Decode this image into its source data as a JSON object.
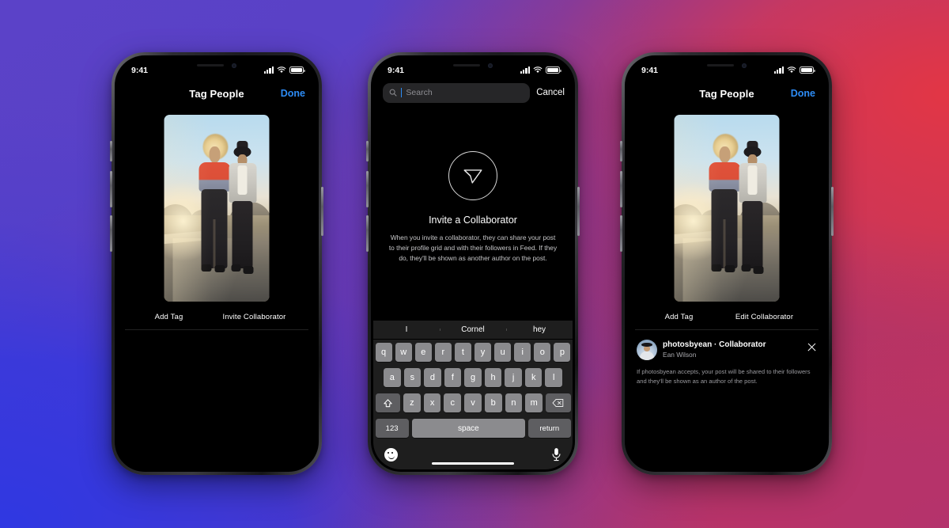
{
  "background": {
    "colors": [
      "#5b42c8",
      "#2f38e2",
      "#e23645",
      "#b4336c"
    ]
  },
  "accent_color": "#2d8cf5",
  "status_bar": {
    "time": "9:41",
    "cellular_icon": "signal-bars-icon",
    "wifi_icon": "wifi-icon",
    "battery_icon": "battery-icon"
  },
  "phones": [
    {
      "id": "phone-tag-people",
      "nav": {
        "title": "Tag People",
        "action": "Done"
      },
      "actions": {
        "left": "Add Tag",
        "right": "Invite Collaborator"
      }
    },
    {
      "id": "phone-invite-search",
      "search": {
        "placeholder": "Search",
        "value": "",
        "icon": "search-icon",
        "cancel": "Cancel"
      },
      "empty_state": {
        "icon": "send-paper-plane-icon",
        "title": "Invite a Collaborator",
        "body": "When you invite a collaborator, they can share your post to their profile grid and with their followers in Feed. If they do, they'll be shown as another author on the post."
      },
      "keyboard": {
        "predictions": [
          "I",
          "Cornel",
          "hey"
        ],
        "row1": [
          "q",
          "w",
          "e",
          "r",
          "t",
          "y",
          "u",
          "i",
          "o",
          "p"
        ],
        "row2": [
          "a",
          "s",
          "d",
          "f",
          "g",
          "h",
          "j",
          "k",
          "l"
        ],
        "row3": [
          "z",
          "x",
          "c",
          "v",
          "b",
          "n",
          "m"
        ],
        "shift_icon": "shift-arrow-icon",
        "backspace_icon": "backspace-icon",
        "numbers_key": "123",
        "space_key": "space",
        "return_key": "return",
        "emoji_icon": "emoji-smiley-icon",
        "dictation_icon": "microphone-icon"
      }
    },
    {
      "id": "phone-collaborator-added",
      "nav": {
        "title": "Tag People",
        "action": "Done"
      },
      "actions": {
        "left": "Add Tag",
        "right": "Edit Collaborator"
      },
      "collaborator": {
        "avatar_icon": "user-avatar",
        "username": "photosbyean · Collaborator",
        "fullname": "Ean Wilson",
        "close_icon": "close-icon",
        "note": "If photosbyean accepts, your post will be shared to their followers and they'll be shown as an author of the post."
      }
    }
  ]
}
